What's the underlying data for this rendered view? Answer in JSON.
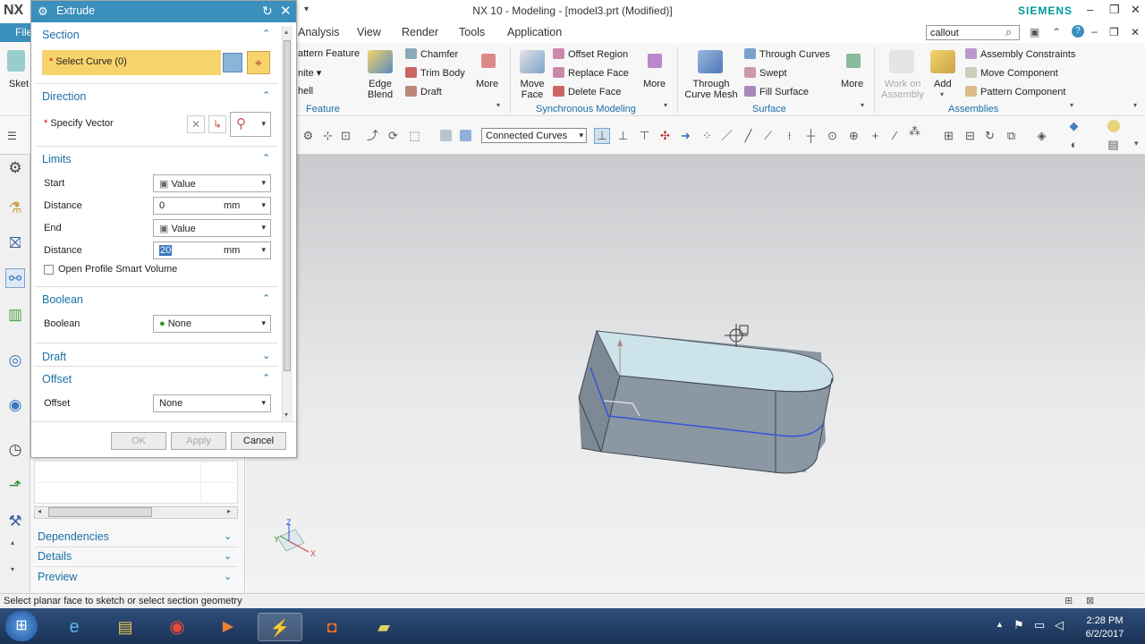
{
  "window": {
    "title": "NX 10 - Modeling - [model3.prt (Modified)]",
    "brand": "SIEMENS",
    "logo": "NX"
  },
  "menu": {
    "file": "File",
    "items": [
      "Analysis",
      "View",
      "Render",
      "Tools",
      "Application"
    ],
    "search_value": "callout"
  },
  "ribbon": {
    "feature": {
      "items": [
        "attern Feature",
        "nite",
        "hell"
      ],
      "edge_blend": "Edge\nBlend",
      "chamfer": "Chamfer",
      "trim_body": "Trim Body",
      "draft": "Draft",
      "more": "More",
      "group_label": "Feature"
    },
    "sync": {
      "move_face": "Move\nFace",
      "offset_region": "Offset Region",
      "replace_face": "Replace Face",
      "delete_face": "Delete Face",
      "more": "More",
      "group_label": "Synchronous Modeling"
    },
    "surface": {
      "through_curve_mesh": "Through\nCurve Mesh",
      "through_curves": "Through Curves",
      "swept": "Swept",
      "fill_surface": "Fill Surface",
      "more": "More",
      "group_label": "Surface"
    },
    "assemblies": {
      "work_on_assembly": "Work on\nAssembly",
      "add": "Add",
      "assembly_constraints": "Assembly Constraints",
      "move_component": "Move Component",
      "pattern_component": "Pattern Component",
      "group_label": "Assemblies"
    }
  },
  "toolbar": {
    "selection_filter": "Connected Curves"
  },
  "dialog": {
    "title": "Extrude",
    "section": {
      "header": "Section",
      "select_curve": "Select Curve (0)"
    },
    "direction": {
      "header": "Direction",
      "specify_vector": "Specify Vector"
    },
    "limits": {
      "header": "Limits",
      "start_label": "Start",
      "start_value": "Value",
      "distance1_label": "Distance",
      "distance1_value": "0",
      "distance1_unit": "mm",
      "end_label": "End",
      "end_value": "Value",
      "distance2_label": "Distance",
      "distance2_value": "20",
      "distance2_unit": "mm",
      "open_profile": "Open Profile Smart Volume"
    },
    "boolean": {
      "header": "Boolean",
      "label": "Boolean",
      "value": "None"
    },
    "draft": {
      "header": "Draft"
    },
    "offset": {
      "header": "Offset",
      "label": "Offset",
      "value": "None"
    },
    "buttons": {
      "ok": "OK",
      "apply": "Apply",
      "cancel": "Cancel"
    }
  },
  "navigator": {
    "dependencies": "Dependencies",
    "details": "Details",
    "preview": "Preview"
  },
  "viewport": {
    "axis_x": "X",
    "axis_y": "Y",
    "axis_z": "Z",
    "model_z": "Z"
  },
  "status": {
    "message": "Select planar face to sketch or select section geometry"
  },
  "taskbar": {
    "time": "2:28 PM",
    "date": "6/2/2017"
  },
  "colors": {
    "accent": "#3a8fbd",
    "highlight": "#f7d36b",
    "brand": "#009999",
    "link": "#1b6fa8"
  }
}
